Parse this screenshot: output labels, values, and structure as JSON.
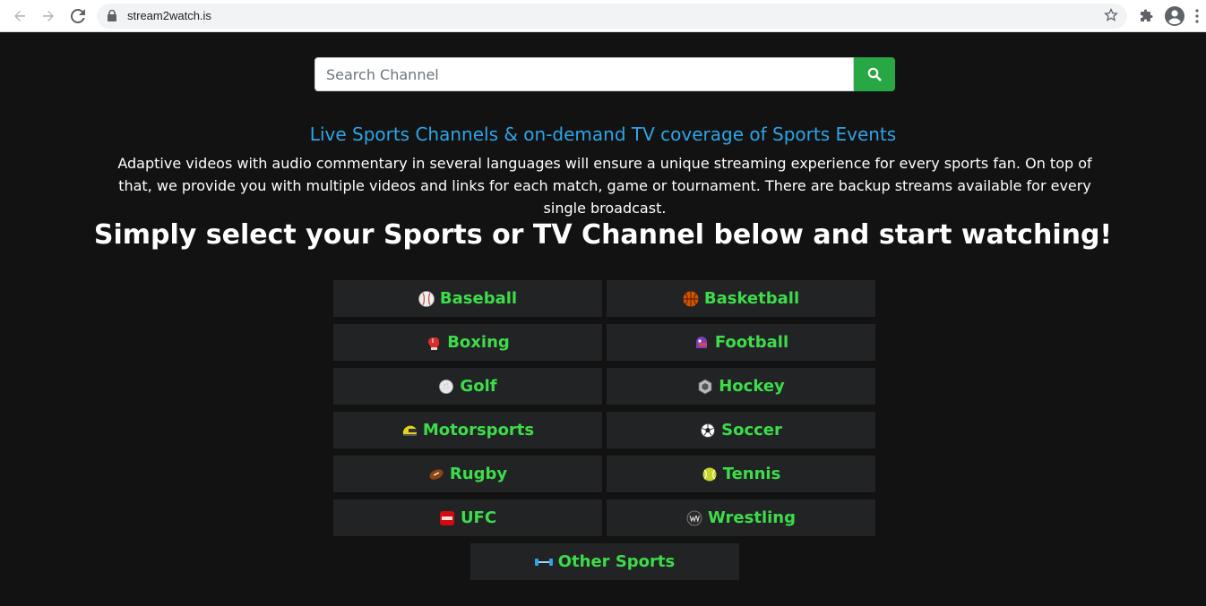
{
  "browser": {
    "url": "stream2watch.is"
  },
  "search": {
    "placeholder": "Search Channel",
    "value": ""
  },
  "content": {
    "subtitle": "Live Sports Channels & on-demand TV coverage of Sports Events",
    "description": "Adaptive videos with audio commentary in several languages will ensure a unique streaming experience for every sports fan. On top of that, we provide you with multiple videos and links for each match, game or tournament. There are backup streams available for every single broadcast.",
    "headline": "Simply select your Sports or TV Channel below and start watching!"
  },
  "sports": [
    {
      "label": "Baseball",
      "icon": "baseball-icon"
    },
    {
      "label": "Basketball",
      "icon": "basketball-icon"
    },
    {
      "label": "Boxing",
      "icon": "boxing-glove-icon"
    },
    {
      "label": "Football",
      "icon": "football-icon"
    },
    {
      "label": "Golf",
      "icon": "golf-ball-icon"
    },
    {
      "label": "Hockey",
      "icon": "hockey-puck-icon"
    },
    {
      "label": "Motorsports",
      "icon": "helmet-icon"
    },
    {
      "label": "Soccer",
      "icon": "soccer-ball-icon"
    },
    {
      "label": "Rugby",
      "icon": "rugby-ball-icon"
    },
    {
      "label": "Tennis",
      "icon": "tennis-ball-icon"
    },
    {
      "label": "UFC",
      "icon": "ufc-icon"
    },
    {
      "label": "Wrestling",
      "icon": "wrestling-icon"
    },
    {
      "label": "Other Sports",
      "icon": "dumbbell-icon"
    }
  ],
  "colors": {
    "background": "#121212",
    "accent_green": "#3ddc4a",
    "button_green": "#28a745",
    "subtitle_blue": "#2fa4e7",
    "tile_bg": "#222324"
  }
}
